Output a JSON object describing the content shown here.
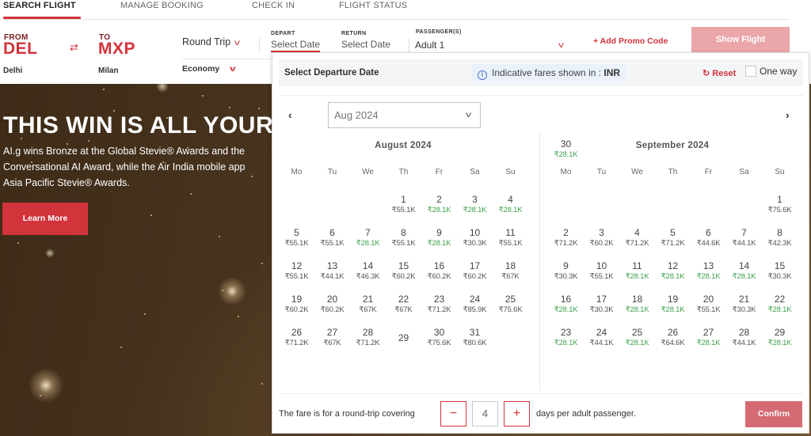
{
  "tabs": [
    {
      "label": "SEARCH FLIGHT",
      "active": true
    },
    {
      "label": "MANAGE BOOKING",
      "active": false
    },
    {
      "label": "CHECK IN",
      "active": false
    },
    {
      "label": "FLIGHT STATUS",
      "active": false
    }
  ],
  "search": {
    "from": {
      "label": "FROM",
      "code": "DEL",
      "city": "Delhi"
    },
    "to": {
      "label": "TO",
      "code": "MXP",
      "city": "Milan"
    },
    "trip_type": "Round Trip",
    "cabin_class": "Economy",
    "depart": {
      "label": "DEPART",
      "value": "Select Date"
    },
    "return": {
      "label": "RETURN",
      "value": "Select Date"
    },
    "passengers": {
      "label": "PASSENGER(S)",
      "value": "Adult 1"
    },
    "promo_label": "+ Add Promo Code",
    "show_flight_label": "Show Flight"
  },
  "hero": {
    "title": "THIS WIN IS ALL YOURS",
    "body_lines": [
      "AI.g wins Bronze at the Global Stevie® Awards and the",
      "Conversational AI Award, while the Air India mobile app",
      "Asia Pacific Stevie® Awards."
    ],
    "cta_label": "Learn More"
  },
  "popup": {
    "title": "Select Departure Date",
    "fare_note": "Indicative fares shown in : ",
    "currency": "INR",
    "reset_label": "Reset",
    "one_way_label": "One way",
    "one_way_checked": false,
    "month_select": "Aug 2024",
    "weekdays": [
      "Mo",
      "Tu",
      "We",
      "Th",
      "Fr",
      "Sa",
      "Su"
    ],
    "low_fare_color": "#3fa34d",
    "calendars": [
      {
        "title": "August 2024",
        "first_weekday_index": 3,
        "days": [
          {
            "d": 1,
            "p": "₹55.1K",
            "low": false
          },
          {
            "d": 2,
            "p": "₹28.1K",
            "low": true
          },
          {
            "d": 3,
            "p": "₹28.1K",
            "low": true
          },
          {
            "d": 4,
            "p": "₹28.1K",
            "low": true
          },
          {
            "d": 5,
            "p": "₹55.1K",
            "low": false
          },
          {
            "d": 6,
            "p": "₹55.1K",
            "low": false
          },
          {
            "d": 7,
            "p": "₹28.1K",
            "low": true
          },
          {
            "d": 8,
            "p": "₹55.1K",
            "low": false
          },
          {
            "d": 9,
            "p": "₹28.1K",
            "low": true
          },
          {
            "d": 10,
            "p": "₹30.3K",
            "low": false
          },
          {
            "d": 11,
            "p": "₹55.1K",
            "low": false
          },
          {
            "d": 12,
            "p": "₹55.1K",
            "low": false
          },
          {
            "d": 13,
            "p": "₹44.1K",
            "low": false
          },
          {
            "d": 14,
            "p": "₹46.3K",
            "low": false
          },
          {
            "d": 15,
            "p": "₹60.2K",
            "low": false
          },
          {
            "d": 16,
            "p": "₹60.2K",
            "low": false
          },
          {
            "d": 17,
            "p": "₹60.2K",
            "low": false
          },
          {
            "d": 18,
            "p": "₹67K",
            "low": false
          },
          {
            "d": 19,
            "p": "₹60.2K",
            "low": false
          },
          {
            "d": 20,
            "p": "₹60.2K",
            "low": false
          },
          {
            "d": 21,
            "p": "₹67K",
            "low": false
          },
          {
            "d": 22,
            "p": "₹67K",
            "low": false
          },
          {
            "d": 23,
            "p": "₹71.2K",
            "low": false
          },
          {
            "d": 24,
            "p": "₹85.9K",
            "low": false
          },
          {
            "d": 25,
            "p": "₹75.6K",
            "low": false
          },
          {
            "d": 26,
            "p": "₹71.2K",
            "low": false
          },
          {
            "d": 27,
            "p": "₹67K",
            "low": false
          },
          {
            "d": 28,
            "p": "₹71.2K",
            "low": false
          },
          {
            "d": 29,
            "p": "",
            "low": false
          },
          {
            "d": 30,
            "p": "₹75.6K",
            "low": false
          },
          {
            "d": 31,
            "p": "₹80.6K",
            "low": false
          }
        ]
      },
      {
        "title": "September 2024",
        "first_weekday_index": 6,
        "days": [
          {
            "d": 1,
            "p": "₹75.6K",
            "low": false
          },
          {
            "d": 2,
            "p": "₹71.2K",
            "low": false
          },
          {
            "d": 3,
            "p": "₹60.2K",
            "low": false
          },
          {
            "d": 4,
            "p": "₹71.2K",
            "low": false
          },
          {
            "d": 5,
            "p": "₹71.2K",
            "low": false
          },
          {
            "d": 6,
            "p": "₹44.6K",
            "low": false
          },
          {
            "d": 7,
            "p": "₹44.1K",
            "low": false
          },
          {
            "d": 8,
            "p": "₹42.3K",
            "low": false
          },
          {
            "d": 9,
            "p": "₹30.3K",
            "low": false
          },
          {
            "d": 10,
            "p": "₹55.1K",
            "low": false
          },
          {
            "d": 11,
            "p": "₹28.1K",
            "low": true
          },
          {
            "d": 12,
            "p": "₹28.1K",
            "low": true
          },
          {
            "d": 13,
            "p": "₹28.1K",
            "low": true
          },
          {
            "d": 14,
            "p": "₹28.1K",
            "low": true
          },
          {
            "d": 15,
            "p": "₹30.3K",
            "low": false
          },
          {
            "d": 16,
            "p": "₹28.1K",
            "low": true
          },
          {
            "d": 17,
            "p": "₹30.3K",
            "low": false
          },
          {
            "d": 18,
            "p": "₹28.1K",
            "low": true
          },
          {
            "d": 19,
            "p": "₹28.1K",
            "low": true
          },
          {
            "d": 20,
            "p": "₹55.1K",
            "low": false
          },
          {
            "d": 21,
            "p": "₹30.3K",
            "low": false
          },
          {
            "d": 22,
            "p": "₹28.1K",
            "low": true
          },
          {
            "d": 23,
            "p": "₹28.1K",
            "low": true
          },
          {
            "d": 24,
            "p": "₹44.1K",
            "low": false
          },
          {
            "d": 25,
            "p": "₹28.1K",
            "low": true
          },
          {
            "d": 26,
            "p": "₹64.6K",
            "low": false
          },
          {
            "d": 27,
            "p": "₹28.1K",
            "low": true
          },
          {
            "d": 28,
            "p": "₹44.1K",
            "low": false
          },
          {
            "d": 29,
            "p": "₹28.1K",
            "low": true
          },
          {
            "d": 30,
            "p": "₹28.1K",
            "low": true
          }
        ]
      }
    ],
    "footer": {
      "text_before": "The fare is for a round-trip covering",
      "minus": "−",
      "days_value": "4",
      "plus": "+",
      "text_after": "days per adult passenger.",
      "confirm_label": "Confirm"
    }
  }
}
